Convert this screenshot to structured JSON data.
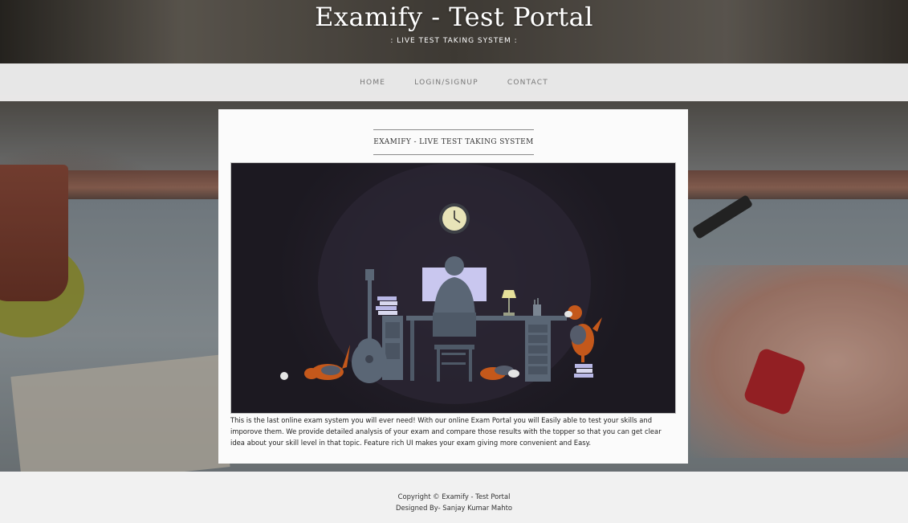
{
  "header": {
    "title": "Examify - Test Portal",
    "tagline": ": LIVE TEST TAKING SYSTEM :"
  },
  "nav": {
    "items": [
      {
        "label": "HOME"
      },
      {
        "label": "LOGIN/SIGNUP"
      },
      {
        "label": "CONTACT"
      }
    ]
  },
  "main": {
    "heading": "EXAMIFY - LIVE TEST TAKING SYSTEM",
    "illustration": "developer-desk-illustration",
    "description": "This is the last online exam system you will ever need! With our online Exam Portal you will Easily able to test your skills and imporove them. We provide detailed analysis of your exam and compare those results with the topper so that you can get clear idea about your skill level in that topic. Feature rich UI makes your exam giving more convenient and Easy."
  },
  "footer": {
    "copyright": "Copyright © Examify - Test Portal",
    "designer": "Designed By- Sanjay Kumar Mahto"
  },
  "colors": {
    "nav_bg": "#f5f5f5",
    "card_bg": "#fbfbfb",
    "illustration_bg": "#221e28",
    "accent_dog": "#c4581b",
    "monitor": "#c9c7ef"
  }
}
